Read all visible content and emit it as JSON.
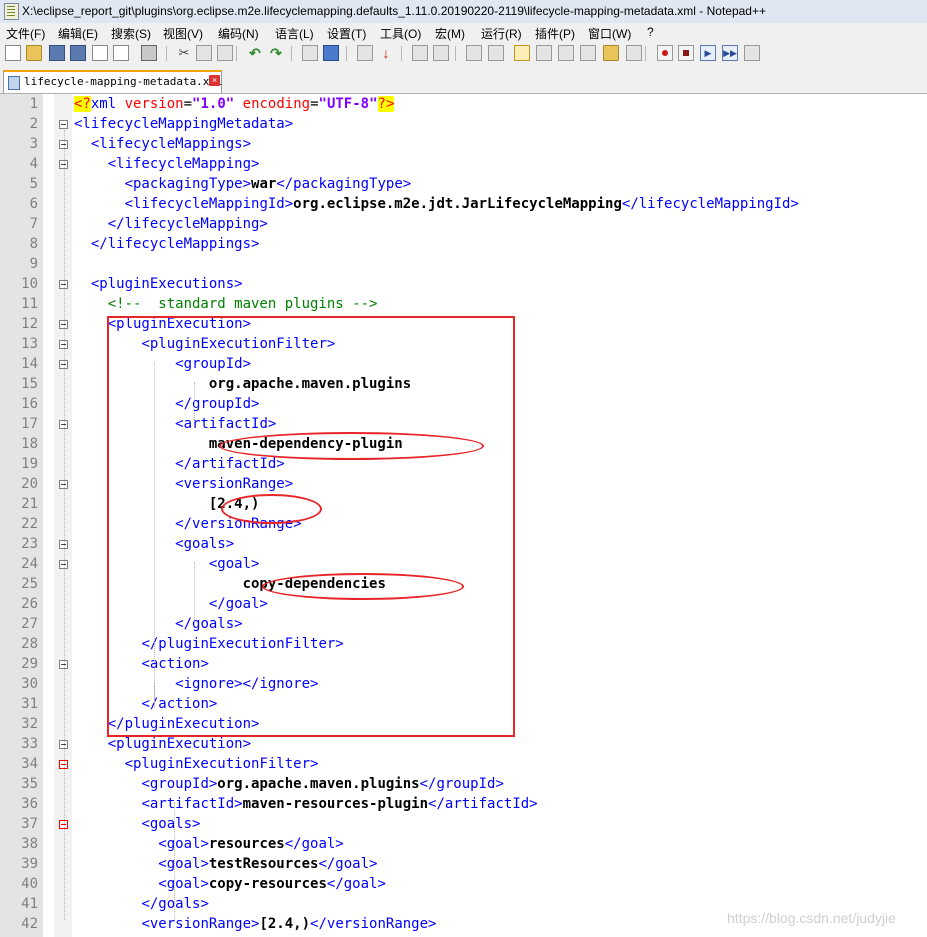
{
  "window": {
    "title": "X:\\eclipse_report_git\\plugins\\org.eclipse.m2e.lifecyclemapping.defaults_1.11.0.20190220-2119\\lifecycle-mapping-metadata.xml - Notepad++"
  },
  "menu": [
    "文件(F)",
    "编辑(E)",
    "搜索(S)",
    "视图(V)",
    "编码(N)",
    "语言(L)",
    "设置(T)",
    "工具(O)",
    "宏(M)",
    "运行(R)",
    "插件(P)",
    "窗口(W)",
    "?"
  ],
  "toolbar": {
    "icons": [
      "new-file-icon",
      "open-file-icon",
      "save-icon",
      "save-all-icon",
      "close-icon",
      "close-all-icon",
      "print-icon",
      "cut-icon",
      "copy-icon",
      "paste-icon",
      "undo-icon",
      "redo-icon",
      "find-icon",
      "replace-icon",
      "zoom-in-icon",
      "zoom-out-icon",
      "sync-vertical-icon",
      "sync-horizontal-icon",
      "word-wrap-icon",
      "show-all-characters-icon",
      "indent-guide-icon",
      "user-defined-language-icon",
      "document-map-icon",
      "function-list-icon",
      "folder-as-workspace-icon",
      "monitoring-icon",
      "record-macro-icon",
      "stop-recording-icon",
      "playback-icon",
      "run-macro-multiple-icon",
      "save-macro-icon"
    ]
  },
  "tab": {
    "filename": "lifecycle-mapping-metadata.xml",
    "close": "×"
  },
  "editor": {
    "lines": [
      {
        "n": "1",
        "code": "<?xml version=\"1.0\" encoding=\"UTF-8\"?>"
      },
      {
        "n": "2",
        "code": "<lifecycleMappingMetadata>"
      },
      {
        "n": "3",
        "code": "  <lifecycleMappings>"
      },
      {
        "n": "4",
        "code": "    <lifecycleMapping>"
      },
      {
        "n": "5",
        "code": "      <packagingType>war</packagingType>"
      },
      {
        "n": "6",
        "code": "      <lifecycleMappingId>org.eclipse.m2e.jdt.JarLifecycleMapping</lifecycleMappingId>"
      },
      {
        "n": "7",
        "code": "    </lifecycleMapping>"
      },
      {
        "n": "8",
        "code": "  </lifecycleMappings>"
      },
      {
        "n": "9",
        "code": ""
      },
      {
        "n": "10",
        "code": "  <pluginExecutions>"
      },
      {
        "n": "11",
        "code": "    <!--  standard maven plugins -->"
      },
      {
        "n": "12",
        "code": "    <pluginExecution>"
      },
      {
        "n": "13",
        "code": "        <pluginExecutionFilter>"
      },
      {
        "n": "14",
        "code": "            <groupId>"
      },
      {
        "n": "15",
        "code": "                org.apache.maven.plugins"
      },
      {
        "n": "16",
        "code": "            </groupId>"
      },
      {
        "n": "17",
        "code": "            <artifactId>"
      },
      {
        "n": "18",
        "code": "                maven-dependency-plugin"
      },
      {
        "n": "19",
        "code": "            </artifactId>"
      },
      {
        "n": "20",
        "code": "            <versionRange>"
      },
      {
        "n": "21",
        "code": "                [2.4,)"
      },
      {
        "n": "22",
        "code": "            </versionRange>"
      },
      {
        "n": "23",
        "code": "            <goals>"
      },
      {
        "n": "24",
        "code": "                <goal>"
      },
      {
        "n": "25",
        "code": "                    copy-dependencies"
      },
      {
        "n": "26",
        "code": "                </goal>"
      },
      {
        "n": "27",
        "code": "            </goals>"
      },
      {
        "n": "28",
        "code": "        </pluginExecutionFilter>"
      },
      {
        "n": "29",
        "code": "        <action>"
      },
      {
        "n": "30",
        "code": "            <ignore></ignore>"
      },
      {
        "n": "31",
        "code": "        </action>"
      },
      {
        "n": "32",
        "code": "    </pluginExecution>"
      },
      {
        "n": "33",
        "code": "    <pluginExecution>"
      },
      {
        "n": "34",
        "code": "      <pluginExecutionFilter>"
      },
      {
        "n": "35",
        "code": "        <groupId>org.apache.maven.plugins</groupId>"
      },
      {
        "n": "36",
        "code": "        <artifactId>maven-resources-plugin</artifactId>"
      },
      {
        "n": "37",
        "code": "        <goals>"
      },
      {
        "n": "38",
        "code": "          <goal>resources</goal>"
      },
      {
        "n": "39",
        "code": "          <goal>testResources</goal>"
      },
      {
        "n": "40",
        "code": "          <goal>copy-resources</goal>"
      },
      {
        "n": "41",
        "code": "        </goals>"
      },
      {
        "n": "42",
        "code": "        <versionRange>[2.4,)</versionRange>"
      }
    ]
  },
  "watermark": "https://blog.csdn.net/judyjie",
  "colors": {
    "tag": "#0000ff",
    "text": "#000000",
    "attribute": "#ff0000",
    "attribute_value": "#8000ff",
    "comment": "#008000",
    "declaration_highlight": "#ffff00",
    "annotation": "#e8262a"
  }
}
